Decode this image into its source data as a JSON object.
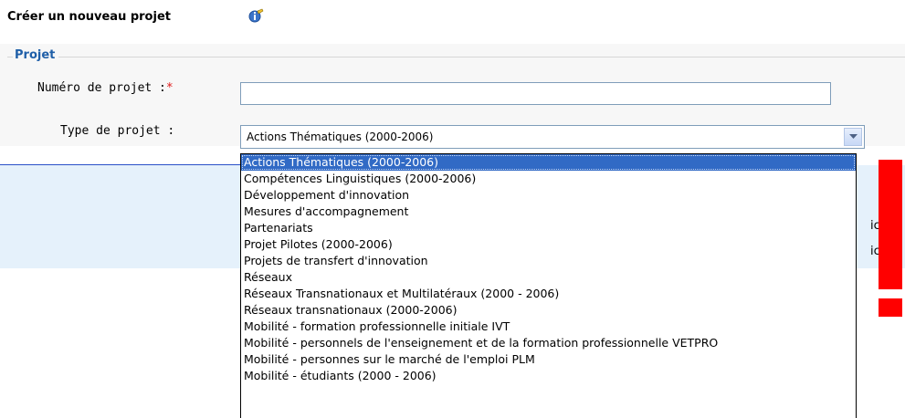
{
  "header": {
    "title": "Créer un nouveau projet",
    "help_icon": "info-pencil-icon"
  },
  "section": {
    "legend": "Projet"
  },
  "form": {
    "numero_label": "Numéro de projet :",
    "required_marker": "*",
    "numero_value": "",
    "type_label": "Type de projet :",
    "type_selected": "Actions Thématiques (2000-2006)",
    "type_arrow_icon": "chevron-down-icon"
  },
  "type_options": [
    "Actions Thématiques (2000-2006)",
    "Compétences Linguistiques (2000-2006)",
    "Développement d'innovation",
    "Mesures d'accompagnement",
    "Partenariats",
    "Projet Pilotes (2000-2006)",
    "Projets de transfert d'innovation",
    "Réseaux",
    "Réseaux Transnationaux et Multilatéraux (2000 - 2006)",
    "Réseaux transnationaux (2000-2006)",
    "Mobilité - formation professionnelle initiale IVT",
    "Mobilité - personnels de l'enseignement et de la formation professionnelle VETPRO",
    "Mobilité - personnes sur le marché de l'emploi PLM",
    "Mobilité - étudiants (2000 - 2006)"
  ],
  "background": {
    "partial_text_1": "icô",
    "partial_text_2": "icô"
  },
  "colors": {
    "legend": "#1f5fa8",
    "selection": "#316ac5",
    "required": "#e01b1b",
    "alert_red": "#ff0000",
    "panel_blue": "#e5f1fb"
  }
}
